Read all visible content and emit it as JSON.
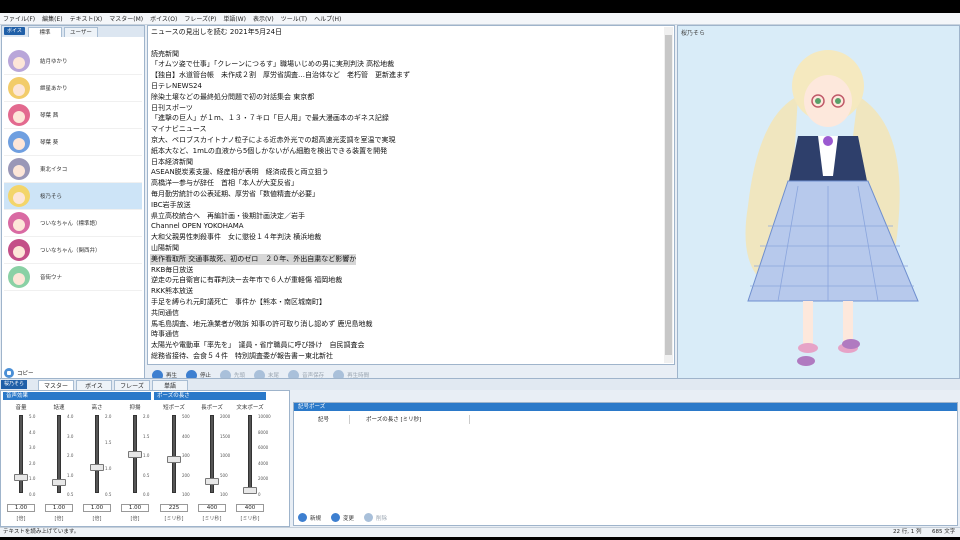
{
  "menu": [
    "ファイル(F)",
    "編集(E)",
    "テキスト(X)",
    "マスター(M)",
    "ボイス(O)",
    "フレーズ(P)",
    "単語(W)",
    "表示(V)",
    "ツール(T)",
    "ヘルプ(H)"
  ],
  "voice_panel": {
    "badge": "ボイス",
    "tabs": [
      "標準",
      "ユーザー"
    ],
    "items": [
      {
        "name": "結月ゆかり",
        "color": "#b9a6d9"
      },
      {
        "name": "紲星あかり",
        "color": "#f2cc6a"
      },
      {
        "name": "琴葉 茜",
        "color": "#e36a8f"
      },
      {
        "name": "琴葉 葵",
        "color": "#6f9fe0"
      },
      {
        "name": "東北イタコ",
        "color": "#9a97b7"
      },
      {
        "name": "桜乃そら",
        "color": "#f3d56a"
      },
      {
        "name": "ついなちゃん（標準語）",
        "color": "#d96aa3"
      },
      {
        "name": "ついなちゃん（関西弁）",
        "color": "#c44f88"
      },
      {
        "name": "音街ウナ",
        "color": "#8ad1a5"
      }
    ],
    "selected_index": 5,
    "copy_label": "コピー"
  },
  "text": {
    "lines": [
      "ニュースの見出しを読む 2021年5月24日",
      "",
      "読売新聞",
      "「オムツ姿で仕事」「クレーンにつるす」職場いじめの男に実刑判決 高松地裁",
      "【独自】水道管台帳　未作成２割　厚労省調査…自治体など　老朽管　更新進まず",
      "日テレNEWS24",
      "除染土壌などの最終処分問題で初の対話集会 東京都",
      "日刊スポーツ",
      "「進撃の巨人」が１m、１３・７キロ「巨人用」で最大漫画本のギネス記録",
      "マイナビニュース",
      "京大、ペロブスカイトナノ粒子による近赤外光での超高速光変調を室温で実現",
      "紙本大など、1mLの血液から5個しかないがん細胞を検出できる装置を開発",
      "日本経済新聞",
      "ASEAN脱炭素支援、経産相が表明　経済成長と両立狙う",
      "高橋洋一参与が辞任　首相「本人が大変反省」",
      "毎月勤労統計の公表延期、厚労省「数値精査が必要」",
      "IBC岩手放送",
      "県立高校統合へ　再編計画・後期計画決定／岩手",
      "Channel OPEN YOKOHAMA",
      "大和父親男性刺殺事件　女に懲役１４年判決 横浜地裁",
      "山陽新聞",
      "美作看取所 交通事故死、初のゼロ　２０年、外出自粛など影響か",
      "RKB毎日放送",
      "逆走の元自衛官に有罪判決ー去年市で６人が重軽傷 福岡地裁",
      "RKK熊本放送",
      "手足を縛られ元町議死亡　事件か【熊本・南区城南町】",
      "共同通信",
      "馬毛島調査、地元漁業者が敗訴 知事の許可取り消し認めず 鹿児島地裁",
      "時事通信",
      "太陽光や電動車「率先を」　議員・省庁職員に呼び掛け　自民調査会",
      "総務省接待、会食５４件　特別調査委が報告書ー東北新社"
    ],
    "highlight_index": 21
  },
  "toolbar": [
    {
      "label": "再生",
      "enabled": true
    },
    {
      "label": "停止",
      "enabled": true
    },
    {
      "label": "先頭",
      "enabled": false
    },
    {
      "label": "末尾",
      "enabled": false
    },
    {
      "label": "音声保存",
      "enabled": false
    },
    {
      "label": "再生時間",
      "enabled": false
    }
  ],
  "character": {
    "name": "桜乃そら"
  },
  "bottom": {
    "badge": "桜乃そら",
    "tabs": [
      "マスター",
      "ボイス",
      "フレーズ",
      "単語"
    ],
    "group1": "音声効果",
    "group2": "ポーズの長さ",
    "sliders": [
      {
        "label": "音量",
        "value": "1.00",
        "unit": "[倍]",
        "ticks": [
          "5.0",
          "4.0",
          "3.0",
          "2.0",
          "1.0",
          "0.0"
        ],
        "level": 0.2
      },
      {
        "label": "話速",
        "value": "1.00",
        "unit": "[倍]",
        "ticks": [
          "4.0",
          "3.0",
          "2.0",
          "1.0",
          "0.5"
        ],
        "level": 0.14
      },
      {
        "label": "高さ",
        "value": "1.00",
        "unit": "[倍]",
        "ticks": [
          "2.0",
          "1.5",
          "1.0",
          "0.5"
        ],
        "level": 0.33
      },
      {
        "label": "抑揚",
        "value": "1.00",
        "unit": "[倍]",
        "ticks": [
          "2.0",
          "1.5",
          "1.0",
          "0.5",
          "0.0"
        ],
        "level": 0.5
      },
      {
        "label": "短ポーズ",
        "value": "225",
        "unit": "[ミリ秒]",
        "ticks": [
          "500",
          "400",
          "300",
          "200",
          "100"
        ],
        "level": 0.43
      },
      {
        "label": "長ポーズ",
        "value": "400",
        "unit": "[ミリ秒]",
        "ticks": [
          "2000",
          "1500",
          "1000",
          "500",
          "100"
        ],
        "level": 0.16
      },
      {
        "label": "文末ポーズ",
        "value": "400",
        "unit": "[ミリ秒]",
        "ticks": [
          "10000",
          "8000",
          "6000",
          "4000",
          "2000",
          "0"
        ],
        "level": 0.04
      }
    ],
    "kigou": {
      "title": "記号ポーズ",
      "col1": "記号",
      "col2": "ポーズの長さ [ミリ秒]",
      "buttons": [
        {
          "label": "新規",
          "enabled": true
        },
        {
          "label": "変更",
          "enabled": true
        },
        {
          "label": "削除",
          "enabled": false
        }
      ]
    }
  },
  "status": {
    "message": "テキストを読み上げています。",
    "position": "22 行, 1 列",
    "chars": "685 文字"
  }
}
